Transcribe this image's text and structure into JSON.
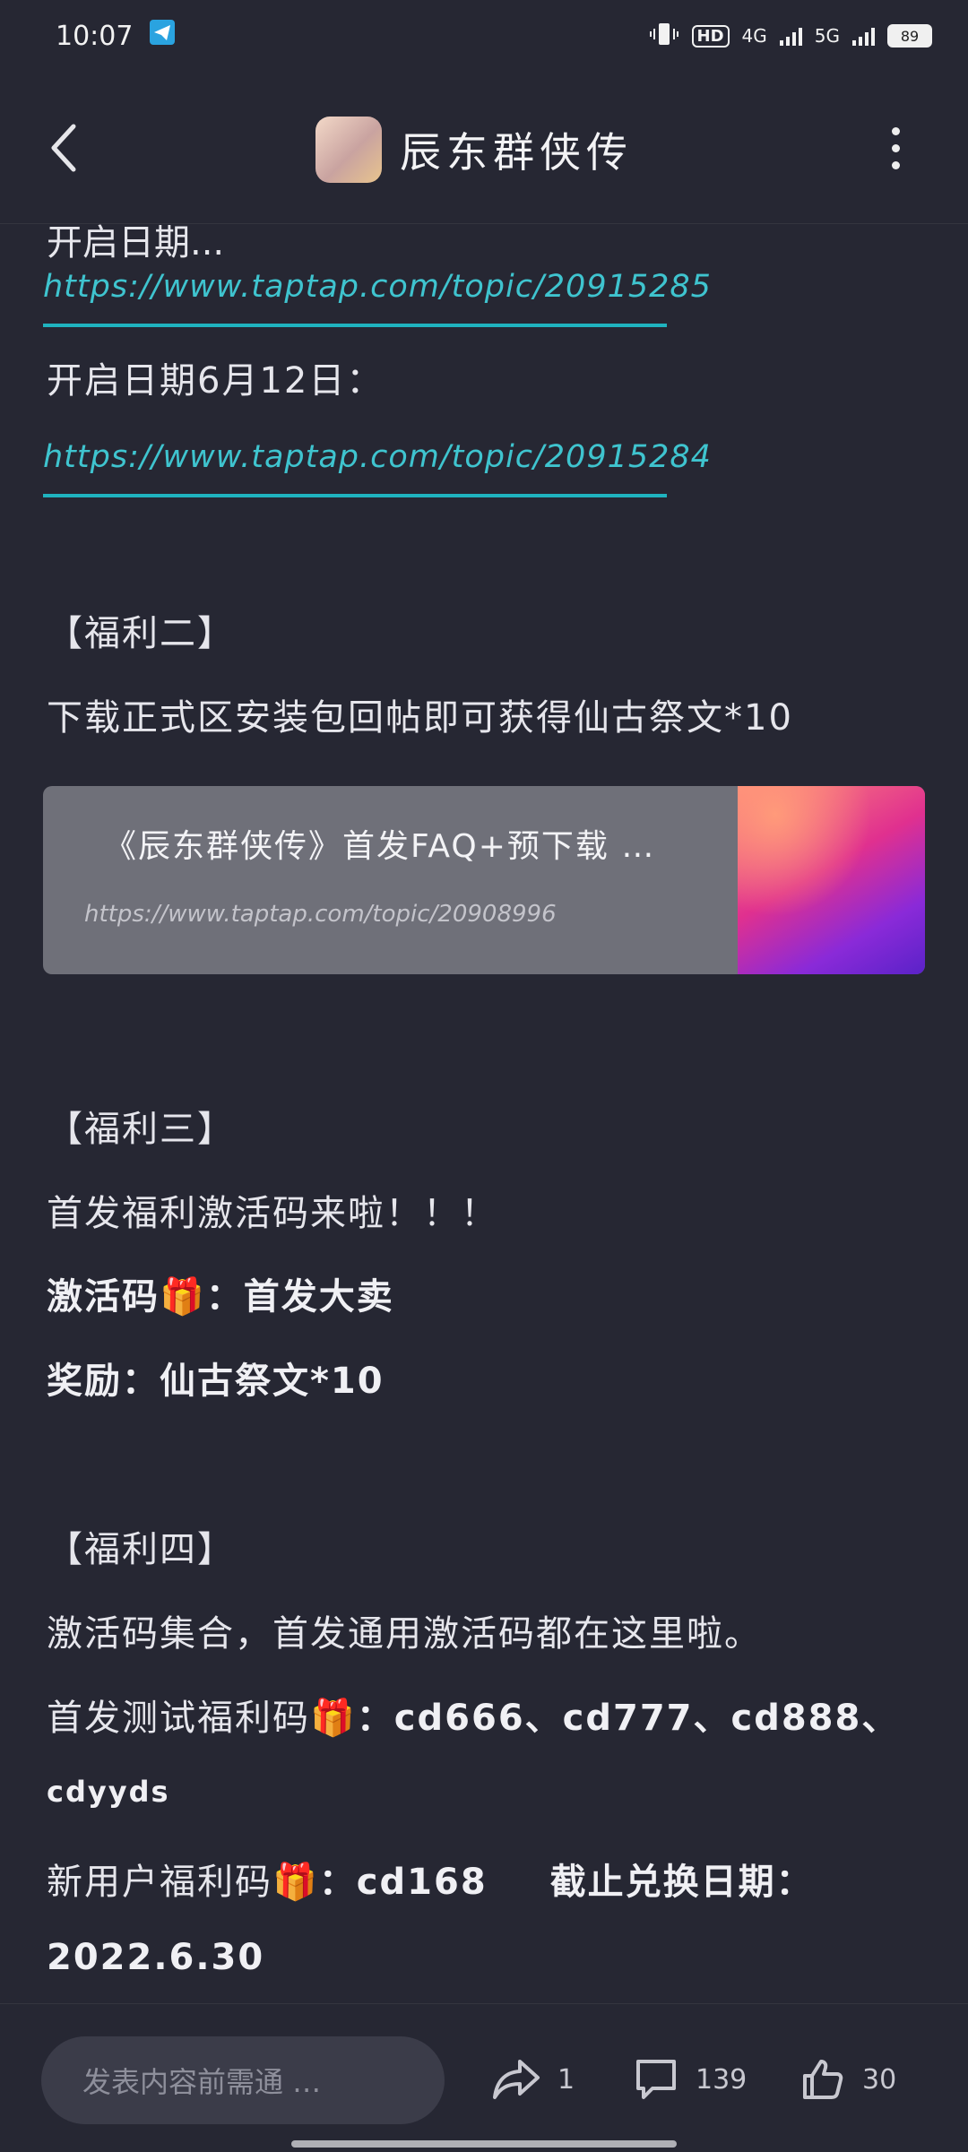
{
  "status_bar": {
    "time": "10:07",
    "hd_label": "HD",
    "net_4g": "4G",
    "net_5g": "5G",
    "battery": "89"
  },
  "header": {
    "title": "辰东群侠传"
  },
  "post": {
    "top_fragment": "开启日期...",
    "link1": "https://www.taptap.com/topic/20915285",
    "open_date": "开启日期6月12日：",
    "link2": "https://www.taptap.com/topic/20915284",
    "benefit2_title": "【福利二】",
    "benefit2_text": "下载正式区安装包回帖即可获得仙古祭文*10",
    "card": {
      "title": "《辰东群侠传》首发FAQ+预下载 …",
      "url": "https://www.taptap.com/topic/20908996"
    },
    "benefit3_title": "【福利三】",
    "benefit3_text": "首发福利激活码来啦！！！",
    "code_label": "激活码",
    "code_value": "：首发大卖",
    "reward": "奖励：仙古祭文*10",
    "benefit4_title": "【福利四】",
    "benefit4_text": "激活码集合，首发通用激活码都在这里啦。",
    "test_code_label": "首发测试福利码",
    "test_code_value": "：cd666、cd777、cd888、",
    "test_code_cont": "cdyyds",
    "new_user_label": "新用户福利码",
    "new_user_value": "：cd168",
    "deadline_label": "截止兑换日期：",
    "deadline_value": "2022.6.30"
  },
  "bottom_bar": {
    "input_placeholder": "发表内容前需通 …",
    "share_count": "1",
    "comment_count": "139",
    "like_count": "30"
  }
}
